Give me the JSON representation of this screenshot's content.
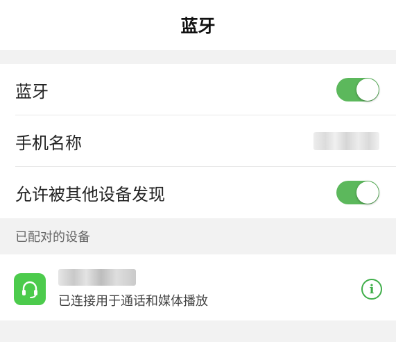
{
  "header": {
    "title": "蓝牙"
  },
  "settings": {
    "bluetooth_label": "蓝牙",
    "bluetooth_on": true,
    "phone_name_label": "手机名称",
    "discoverable_label": "允许被其他设备发现",
    "discoverable_on": true
  },
  "paired": {
    "section_title": "已配对的设备",
    "devices": [
      {
        "status": "已连接用于通话和媒体播放",
        "icon": "headset-icon"
      }
    ]
  },
  "colors": {
    "accent": "#5cb85c",
    "device_icon_bg": "#4ccb4c",
    "info": "#3fae49"
  }
}
